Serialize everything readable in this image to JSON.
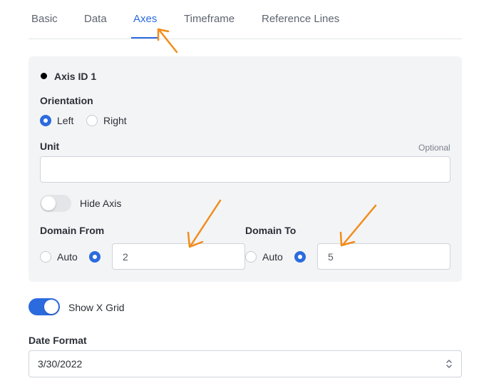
{
  "tabs": [
    {
      "label": "Basic",
      "active": false
    },
    {
      "label": "Data",
      "active": false
    },
    {
      "label": "Axes",
      "active": true
    },
    {
      "label": "Timeframe",
      "active": false
    },
    {
      "label": "Reference Lines",
      "active": false
    }
  ],
  "axis": {
    "title": "Axis ID 1",
    "orientation": {
      "label": "Orientation",
      "options": [
        "Left",
        "Right"
      ],
      "selected": "Left"
    },
    "unit": {
      "label": "Unit",
      "hint": "Optional",
      "value": ""
    },
    "hide_axis": {
      "label": "Hide Axis",
      "enabled": false
    },
    "domain_from": {
      "label": "Domain From",
      "auto_label": "Auto",
      "mode": "custom",
      "value": "2"
    },
    "domain_to": {
      "label": "Domain To",
      "auto_label": "Auto",
      "mode": "custom",
      "value": "5"
    }
  },
  "show_x_grid": {
    "label": "Show X Grid",
    "enabled": true
  },
  "date_format": {
    "label": "Date Format",
    "value": "3/30/2022"
  },
  "colors": {
    "accent": "#2c6bde",
    "annotation": "#f28c1a",
    "panel_bg": "#f3f4f6"
  }
}
